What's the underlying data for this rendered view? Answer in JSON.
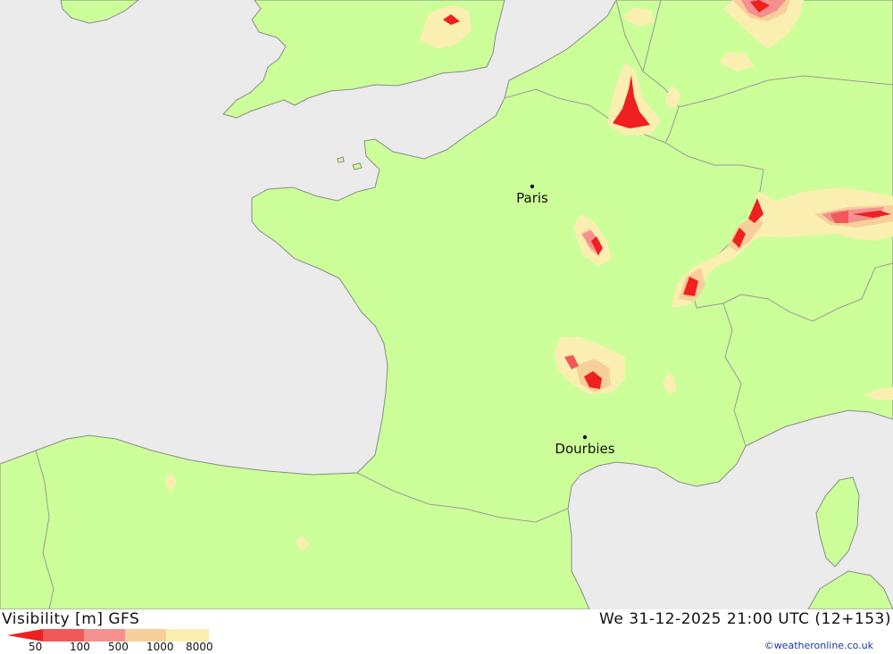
{
  "map": {
    "title": "Visibility [m] GFS",
    "timestamp": "We 31-12-2025 21:00 UTC (12+153)",
    "credit": "©weatheronline.co.uk",
    "cities": [
      {
        "name": "Paris"
      },
      {
        "name": "Dourbies"
      }
    ],
    "legend": {
      "labels": [
        "50",
        "100",
        "500",
        "1000",
        "8000"
      ],
      "colors": [
        "#ee2020",
        "#f25858",
        "#f49090",
        "#f8cf9a",
        "#faefb0"
      ]
    },
    "colors": {
      "sea": "#ebebeb",
      "land": "#ccff99",
      "border": "#9a9a9a"
    }
  }
}
